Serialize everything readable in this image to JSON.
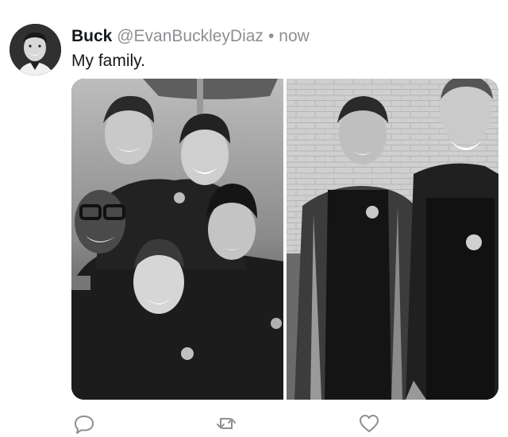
{
  "tweet": {
    "display_name": "Buck",
    "handle": "@EvanBuckleyDiaz",
    "separator": "•",
    "timestamp": "now",
    "text": "My family."
  },
  "media": {
    "photo_count": 2,
    "style": "black-and-white"
  },
  "actions": {
    "icons": [
      "reply-icon",
      "retweet-icon",
      "like-icon"
    ],
    "icon_color": "#8e8e93"
  }
}
